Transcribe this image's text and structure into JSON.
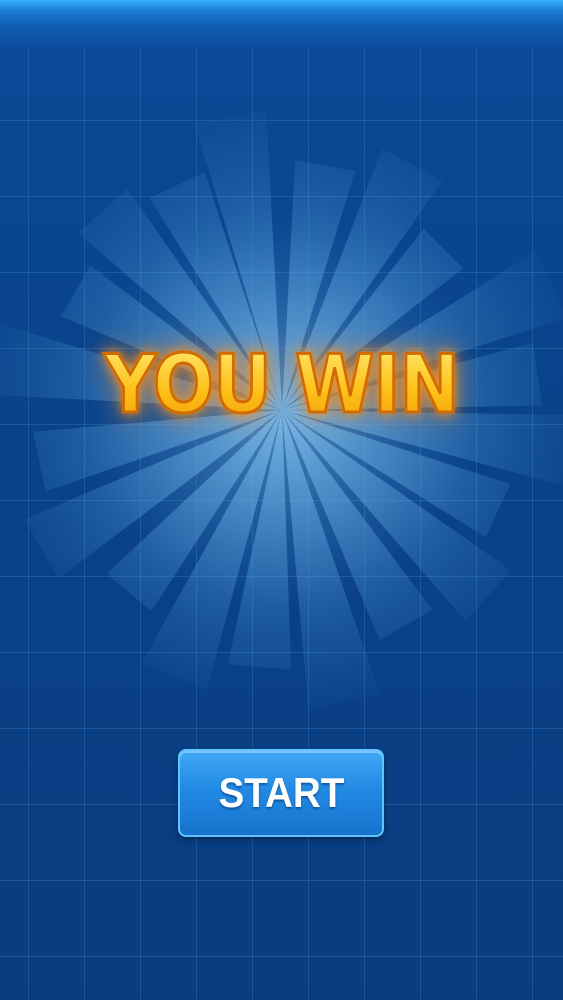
{
  "title": "YOU WIN",
  "start_button": {
    "label": "START"
  },
  "colors": {
    "background": "#0a4289",
    "top_bar": "#1d7bd6",
    "title_fill": "#ffc81c",
    "title_outline": "#d06a05",
    "button_fill": "#228ae4",
    "button_text": "#ffffff"
  }
}
